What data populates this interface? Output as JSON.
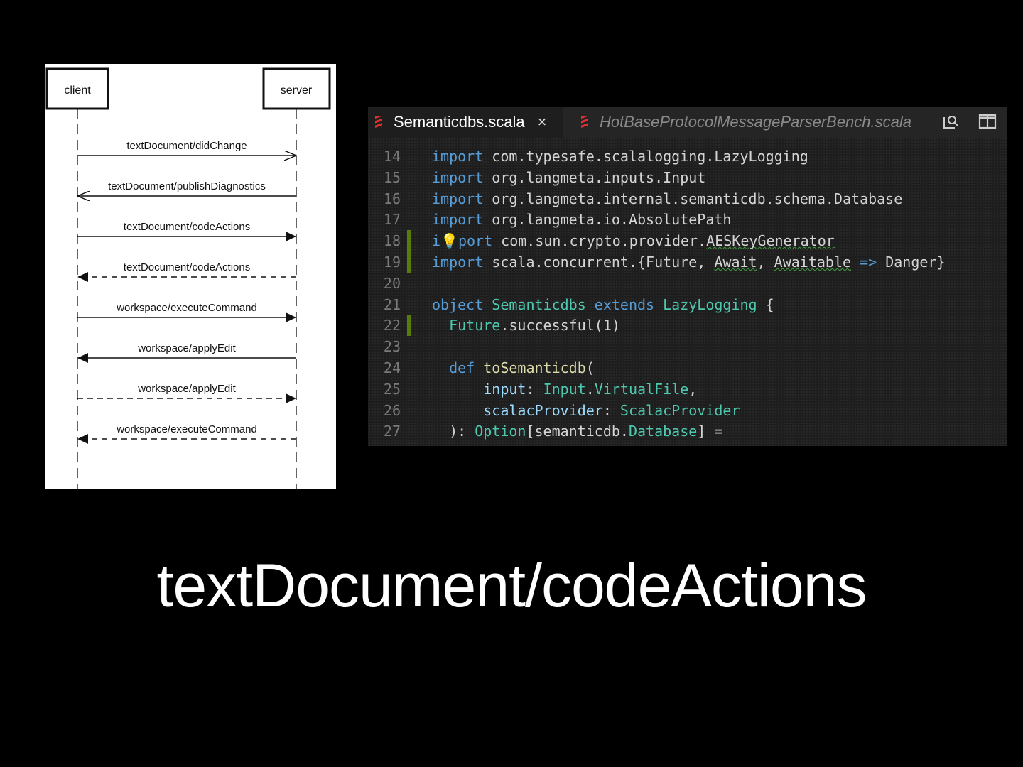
{
  "diagram": {
    "client_label": "client",
    "server_label": "server",
    "messages": [
      {
        "label": "textDocument/didChange",
        "direction": "client-to-server",
        "style": "solid",
        "arrow": "open"
      },
      {
        "label": "textDocument/publishDiagnostics",
        "direction": "server-to-client",
        "style": "solid",
        "arrow": "open"
      },
      {
        "label": "textDocument/codeActions",
        "direction": "client-to-server",
        "style": "solid",
        "arrow": "filled"
      },
      {
        "label": "textDocument/codeActions",
        "direction": "server-to-client",
        "style": "dashed",
        "arrow": "filled"
      },
      {
        "label": "workspace/executeCommand",
        "direction": "client-to-server",
        "style": "solid",
        "arrow": "filled"
      },
      {
        "label": "workspace/applyEdit",
        "direction": "server-to-client",
        "style": "solid",
        "arrow": "filled"
      },
      {
        "label": "workspace/applyEdit",
        "direction": "client-to-server",
        "style": "dashed",
        "arrow": "filled"
      },
      {
        "label": "workspace/executeCommand",
        "direction": "server-to-client",
        "style": "dashed",
        "arrow": "filled"
      }
    ]
  },
  "editor": {
    "tabs": [
      {
        "label": "Semanticdbs.scala",
        "active": true,
        "close": "×"
      },
      {
        "label": "HotBaseProtocolMessageParserBench.scala",
        "active": false
      }
    ],
    "toolbar_icons": [
      "open-changes-icon",
      "split-editor-icon"
    ],
    "lines": [
      {
        "num": "14",
        "html": "<span class='kw'>import</span> com.typesafe.scalalogging.LazyLogging"
      },
      {
        "num": "15",
        "html": "<span class='kw'>import</span> org.langmeta.inputs.Input"
      },
      {
        "num": "16",
        "html": "<span class='kw'>import</span> org.langmeta.internal.semanticdb.schema.Database"
      },
      {
        "num": "17",
        "html": "<span class='kw'>import</span> org.langmeta.io.AbsolutePath"
      },
      {
        "num": "18",
        "html": "<span class='kw'>i<span class='bulb'>💡</span>port</span> com.sun.crypto.provider.<span class='wavy'>AESKeyGenerator</span>",
        "modified": true
      },
      {
        "num": "19",
        "html": "<span class='kw'>import</span> scala.concurrent.{Future, <span class='wavy'>Await</span>, <span class='wavy'>Awaitable</span> <span class='op'>=&gt;</span> Danger}",
        "modified": true
      },
      {
        "num": "20",
        "html": ""
      },
      {
        "num": "21",
        "html": "<span class='kw'>object</span> <span class='ty'>Semanticdbs</span> <span class='kw'>extends</span> <span class='ty'>LazyLogging</span> {"
      },
      {
        "num": "22",
        "html": "  <span class='ty'>Future</span>.successful(1)",
        "modified": true
      },
      {
        "num": "23",
        "html": ""
      },
      {
        "num": "24",
        "html": "  <span class='kw'>def</span> <span class='fn'>toSemanticdb</span>("
      },
      {
        "num": "25",
        "html": "      <span class='pm'>input</span>: <span class='ty'>Input</span>.<span class='ty'>VirtualFile</span>,"
      },
      {
        "num": "26",
        "html": "      <span class='pm'>scalacProvider</span>: <span class='ty'>ScalacProvider</span>"
      },
      {
        "num": "27",
        "html": "  ): <span class='ty'>Option</span>[semanticdb.<span class='ty'>Database</span>] ="
      }
    ]
  },
  "caption": "textDocument/codeActions"
}
